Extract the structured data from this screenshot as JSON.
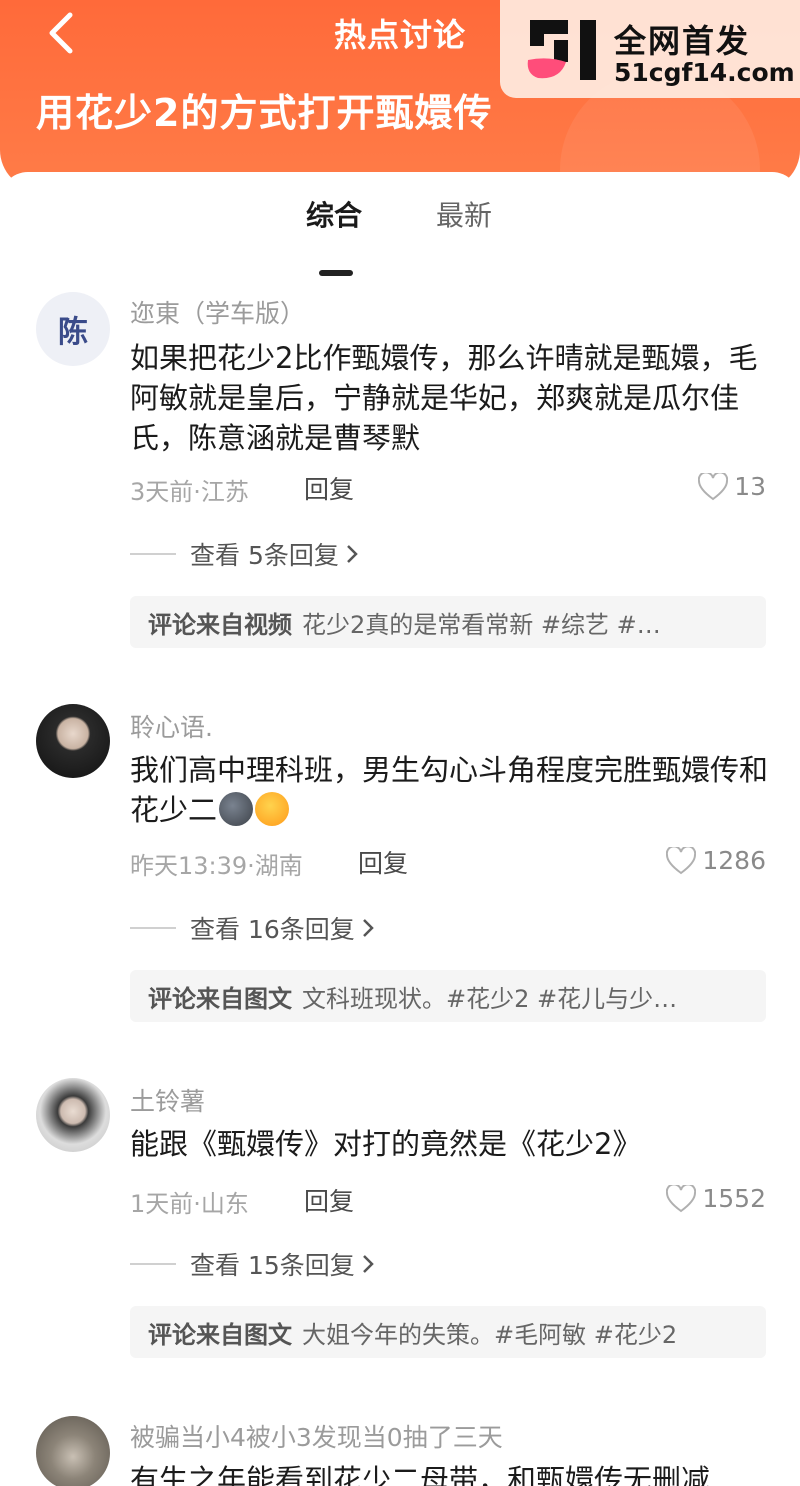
{
  "header": {
    "title": "热点讨论",
    "topic": "用花少2的方式打开甄嬛传"
  },
  "watermark": {
    "line1": "全网首发",
    "line2": "51cgf14.com"
  },
  "tabs": [
    {
      "label": "综合",
      "active": true
    },
    {
      "label": "最新",
      "active": false
    }
  ],
  "comments": [
    {
      "user": "迩東（学车版）",
      "avatar_text": "陈",
      "text": "如果把花少2比作甄嬛传，那么许晴就是甄嬛，毛阿敏就是皇后，宁静就是华妃，郑爽就是瓜尔佳氏，陈意涵就是曹琴默",
      "meta": "3天前·江苏",
      "reply_label": "回复",
      "likes": "13",
      "view_replies": "查看 5条回复",
      "source_label": "评论来自视频",
      "source_text": "花少2真的是常看常新 #综艺 #…"
    },
    {
      "user": "聆心语.",
      "text": "我们高中理科班，男生勾心斗角程度完胜甄嬛传和花少二",
      "meta": "昨天13:39·湖南",
      "reply_label": "回复",
      "likes": "1286",
      "view_replies": "查看 16条回复",
      "source_label": "评论来自图文",
      "source_text": "文科班现状。#花少2 #花儿与少…"
    },
    {
      "user": "土铃薯",
      "text": "能跟《甄嬛传》对打的竟然是《花少2》",
      "meta": "1天前·山东",
      "reply_label": "回复",
      "likes": "1552",
      "view_replies": "查看 15条回复",
      "source_label": "评论来自图文",
      "source_text": "大姐今年的失策。#毛阿敏 #花少2"
    },
    {
      "user": "被骗当小4被小3发现当0抽了三天",
      "text": "有生之年能看到花少二母带，和甄嬛传无删减"
    }
  ],
  "colors": {
    "header_orange": "#ff6a3a",
    "like_gray": "#8a8a8a"
  }
}
